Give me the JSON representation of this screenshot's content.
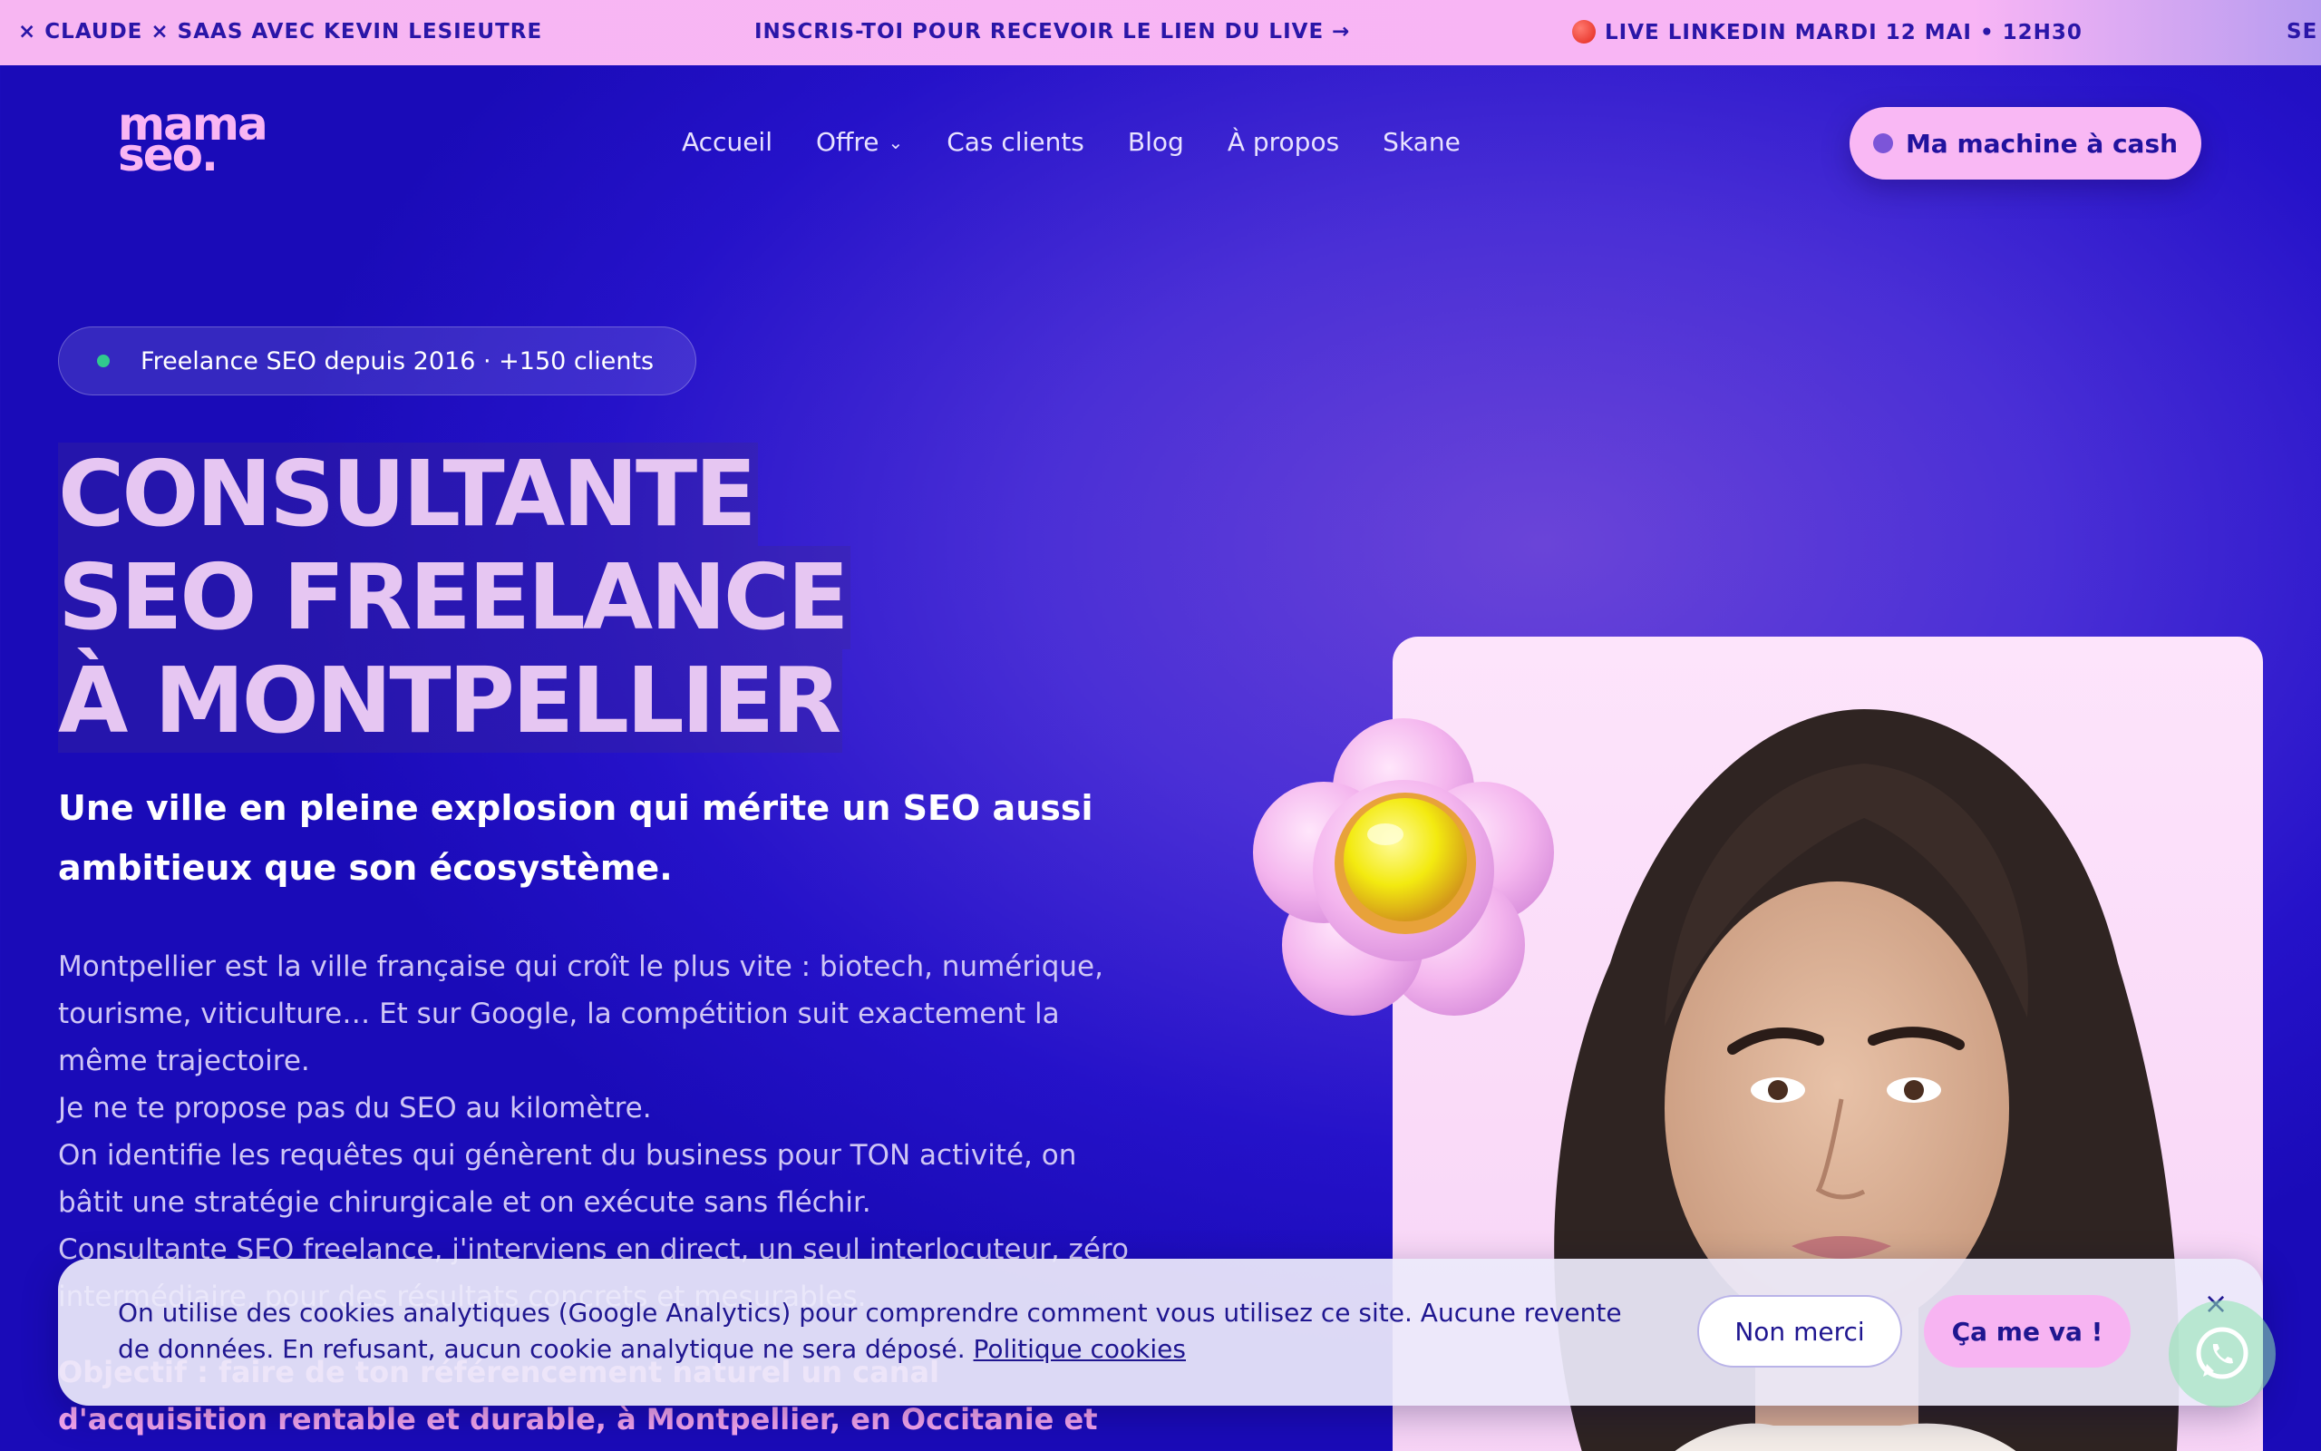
{
  "ticker": {
    "item1": "× CLAUDE × SAAS AVEC KEVIN LESIEUTRE",
    "item2": "INSCRIS-TOI POUR RECEVOIR LE LIEN DU LIVE →",
    "item3": "LIVE LINKEDIN MARDI 12 MAI • 12H30",
    "item4": "SE"
  },
  "header": {
    "logo_line1": "mama",
    "logo_line2": "seo.",
    "nav": [
      "Accueil",
      "Offre",
      "Cas clients",
      "Blog",
      "À propos",
      "Skane"
    ],
    "cta": "Ma machine à cash"
  },
  "hero": {
    "badge": "Freelance SEO depuis 2016 · +150 clients",
    "title_lines": [
      "CONSULTANTE",
      "SEO FREELANCE",
      "À MONTPELLIER"
    ],
    "subtitle": "Une ville en pleine explosion qui mérite un SEO aussi ambitieux que son écosystème.",
    "paragraphs": [
      "Montpellier est la ville française qui croît le plus vite : biotech, numérique, tourisme, viticulture… Et sur Google, la compétition suit exactement la même trajectoire.",
      "Je ne te propose pas du SEO au kilomètre.",
      "On identifie les requêtes qui génèrent du business pour TON activité, on bâtit une stratégie chirurgicale et on exécute sans fléchir.",
      "Consultante SEO freelance, j'interviens en direct, un seul interlocuteur, zéro intermédiaire, pour des résultats concrets et mesurables."
    ],
    "objective": "Objectif : faire de ton référencement naturel un canal d'acquisition rentable et durable, à Montpellier, en Occitanie et au-delà."
  },
  "cookie": {
    "text": "On utilise des cookies analytiques (Google Analytics) pour comprendre comment vous utilisez ce site. Aucune revente de données. En refusant, aucun cookie analytique ne sera déposé.",
    "link": "Politique cookies",
    "decline": "Non merci",
    "accept": "Ça me va !",
    "close": "×"
  },
  "colors": {
    "accent_pink": "#f7b4f2",
    "brand_blue": "#2512c9",
    "text_navy": "#1f1690",
    "status_green": "#31c98e"
  }
}
